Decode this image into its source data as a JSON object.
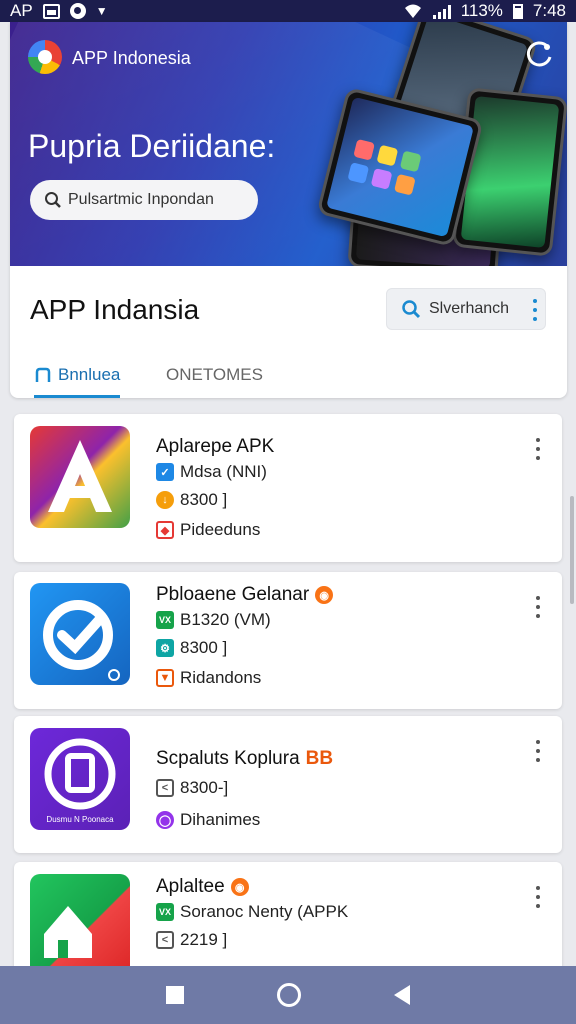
{
  "status_bar": {
    "left": "AP",
    "battery": "113%",
    "time": "7:48"
  },
  "banner": {
    "brand": "APP Indonesia",
    "headline": "Pupria Deriidane:",
    "search_text": "Pulsartmic Inpondan"
  },
  "header": {
    "title": "APP Indansia",
    "action_label": "Slverhanch"
  },
  "tabs": [
    {
      "label": "Bnnluea"
    },
    {
      "label": "ONETOMES"
    }
  ],
  "apps": [
    {
      "name": "Aplarepe APK",
      "line1": "Mdsa (NNI)",
      "line2": "8300 ]",
      "line3": "Pideeduns"
    },
    {
      "name": "Pbloaene Gelanar",
      "line1": "B1320 (VM)",
      "line2": "8300 ]",
      "line3": "Ridandons"
    },
    {
      "name": "Scpaluts Koplura",
      "line1": "8300-]",
      "line2": "Dihanimes",
      "badge": "BB",
      "icon_caption": "Dusmu N Poonaca"
    },
    {
      "name": "Aplaltee",
      "line1": "Soranoc Nenty (APPK",
      "line2": "2219 ]"
    }
  ],
  "colors": {
    "status_bar": "#1c1d4d",
    "accent": "#1a8ad0",
    "nav_bar": "#6f7aa6"
  }
}
